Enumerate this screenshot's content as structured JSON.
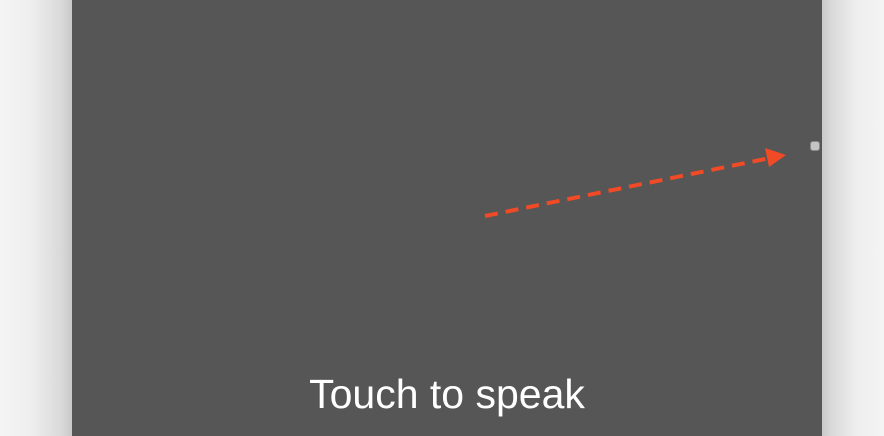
{
  "panel": {
    "prompt_label": "Touch to speak",
    "background_color": "#565656",
    "text_color": "#ffffff"
  },
  "annotation": {
    "icon": "dashed-arrow-icon",
    "color": "#f04a26"
  },
  "handle": {
    "icon": "resize-handle"
  }
}
